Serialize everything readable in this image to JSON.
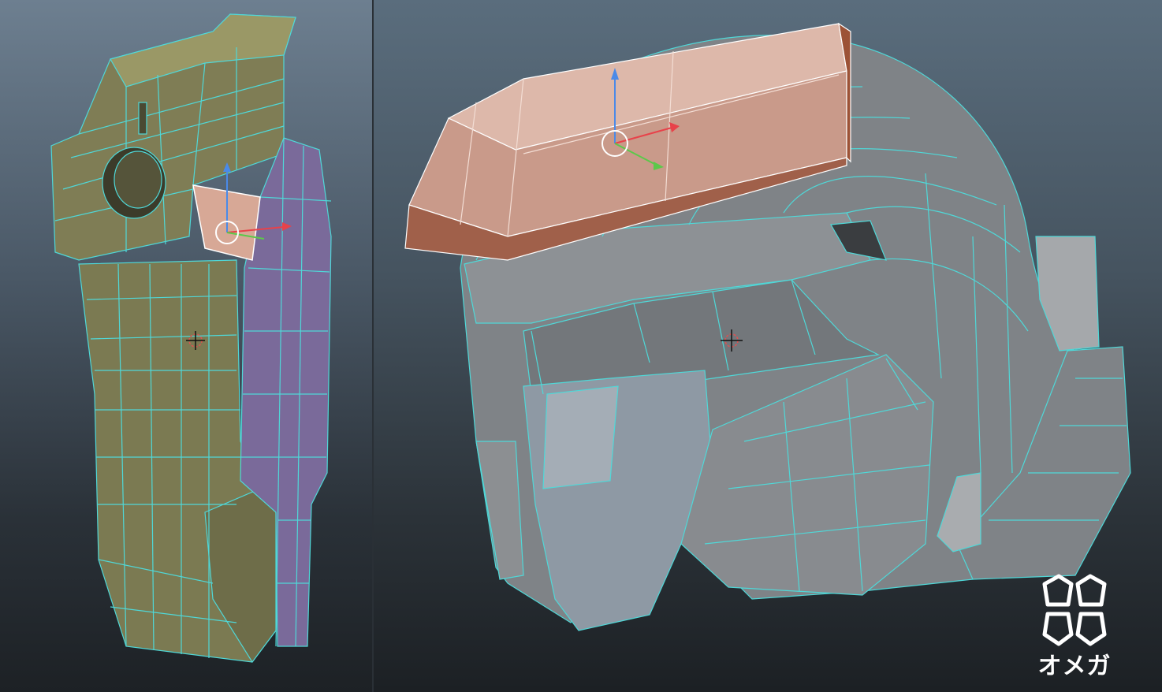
{
  "logo": {
    "text": "オメガ",
    "icon": "four-pentagon-logo-icon"
  },
  "viewports": [
    {
      "name": "torso-viewport",
      "object": "torso-mesh",
      "selected_color": "#d7a896",
      "mesh_color": "#8a8a62",
      "accent_color": "#7a6a9a"
    },
    {
      "name": "helmet-viewport",
      "object": "helmet-mesh",
      "selected_color": "#c99a8a",
      "mesh_color": "#7f8387"
    }
  ],
  "colors": {
    "wire": "#4fd8d8",
    "axis_x": "#e8424a",
    "axis_y": "#5cc84a",
    "axis_z": "#4a8ae8"
  }
}
